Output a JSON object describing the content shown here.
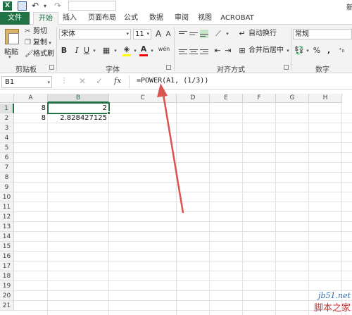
{
  "window": {
    "app_icon": "X",
    "title_fragment": "新"
  },
  "tabs": [
    {
      "label": "文件"
    },
    {
      "label": "开始"
    },
    {
      "label": "插入"
    },
    {
      "label": "页面布局"
    },
    {
      "label": "公式"
    },
    {
      "label": "数据"
    },
    {
      "label": "审阅"
    },
    {
      "label": "视图"
    },
    {
      "label": "ACROBAT"
    }
  ],
  "ribbon": {
    "clipboard": {
      "paste_label": "粘贴",
      "cut_label": "剪切",
      "copy_label": "复制",
      "format_painter_label": "格式刷",
      "group_label": "剪贴板"
    },
    "font": {
      "font_name": "宋体",
      "font_size": "11",
      "grow_label": "A",
      "shrink_label": "A",
      "bold": "B",
      "italic": "I",
      "underline": "U",
      "font_color_label": "A",
      "phonetic_label": "wén",
      "group_label": "字体",
      "fill_color": "#ffff00",
      "font_color": "#ff0000"
    },
    "alignment": {
      "wrap_text_label": "自动换行",
      "merge_center_label": "合并后居中",
      "group_label": "对齐方式"
    },
    "number": {
      "format": "常规",
      "percent": "%",
      "comma": ",",
      "group_label": "数字"
    }
  },
  "formula_bar": {
    "name_box": "B1",
    "fx_label": "fx",
    "formula": "=POWER(A1, (1/3))"
  },
  "sheet": {
    "columns": [
      "A",
      "B",
      "C",
      "D",
      "E",
      "F",
      "G",
      "H"
    ],
    "rows": [
      "1",
      "2",
      "3",
      "4",
      "5",
      "6",
      "7",
      "8",
      "9",
      "10",
      "11",
      "12",
      "13",
      "14",
      "15",
      "16",
      "17",
      "18",
      "19",
      "20",
      "21"
    ],
    "cells": {
      "A1": "8",
      "B1": "2",
      "A2": "8",
      "B2": "2.828427125"
    },
    "accent_color": "#217346"
  },
  "annotation": {
    "arrow_color": "#d9534f"
  },
  "watermark": {
    "url": "jb51.net",
    "name": "脚本之家"
  }
}
